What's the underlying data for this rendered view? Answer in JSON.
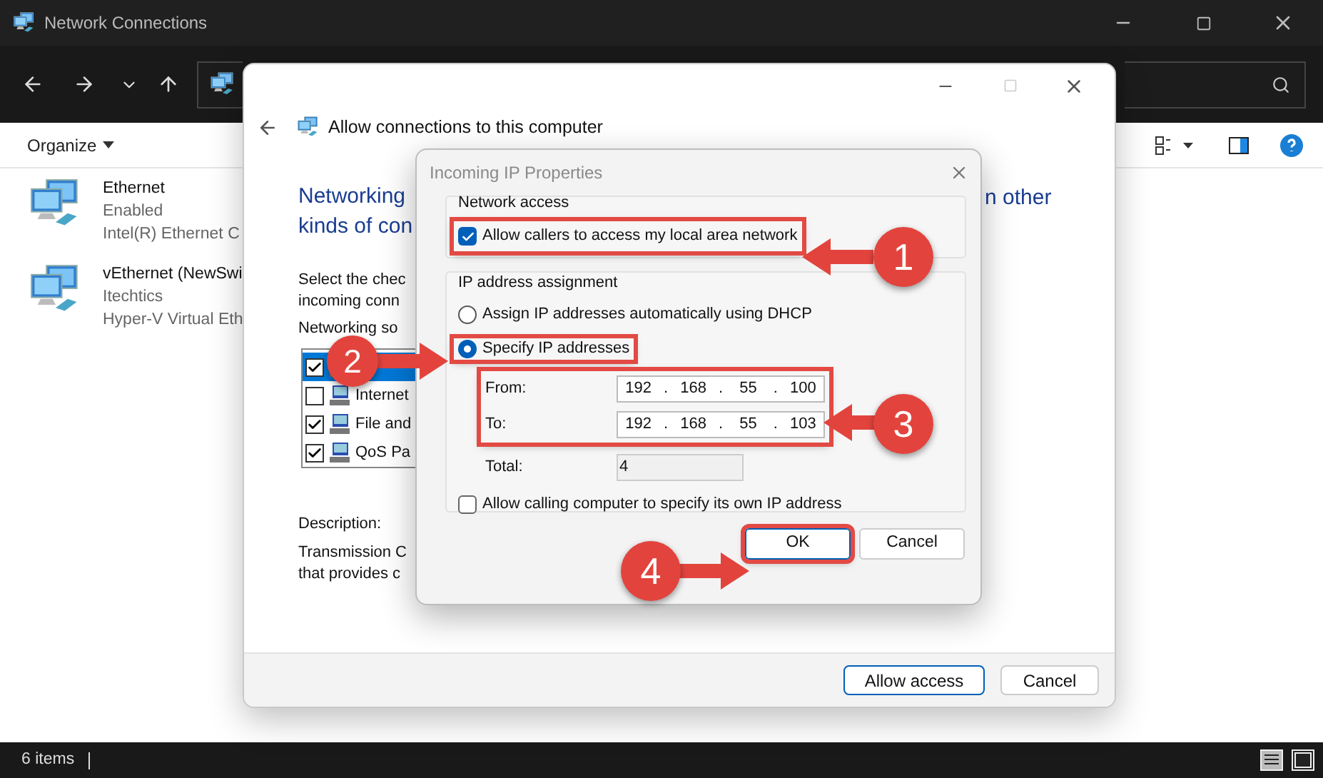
{
  "explorer": {
    "title": "Network Connections",
    "organize": "Organize",
    "connections": [
      {
        "name": "Ethernet",
        "status": "Enabled",
        "device": "Intel(R) Ethernet C"
      },
      {
        "name": "vEthernet (NewSwi",
        "status": "Itechtics",
        "device": "Hyper-V Virtual Eth"
      }
    ],
    "status_bar": "6 items"
  },
  "wizard": {
    "title": "Allow connections to this computer",
    "heading_lines": [
      "Networking",
      "kinds of con"
    ],
    "heading_right": "n other",
    "instructions": [
      "Select the chec",
      "incoming conn"
    ],
    "software_label": "Networking so",
    "software": [
      {
        "checked": true,
        "selected": true
      },
      {
        "label": "Internet",
        "checked": false,
        "selected": false
      },
      {
        "label": "File and",
        "checked": true,
        "selected": false
      },
      {
        "label": "QoS Pa",
        "checked": true,
        "selected": false
      }
    ],
    "description_label": "Description:",
    "description_lines": [
      "Transmission C",
      "that provides c"
    ],
    "buttons": [
      {
        "label": "Allow access",
        "default": true
      },
      {
        "label": "Cancel",
        "default": false
      }
    ]
  },
  "dialog": {
    "title": "Incoming IP Properties",
    "network_access": {
      "legend": "Network access",
      "checkbox": {
        "label": "Allow callers to access my local area network",
        "checked": true,
        "highlighted": true
      }
    },
    "ip_assignment": {
      "legend": "IP address assignment",
      "options": [
        {
          "label": "Assign IP addresses automatically using DHCP",
          "selected": false,
          "highlighted": false
        },
        {
          "label": "Specify IP addresses",
          "selected": true,
          "highlighted": true
        }
      ],
      "range_highlighted": true,
      "separator": ".",
      "range": [
        {
          "label": "From:",
          "octets": [
            "192",
            "168",
            "55",
            "100"
          ]
        },
        {
          "label": "To:",
          "octets": [
            "192",
            "168",
            "55",
            "103"
          ]
        }
      ],
      "total": {
        "label": "Total:",
        "value": "4"
      },
      "own_ip": {
        "label": "Allow calling computer to specify its own IP address",
        "checked": false
      }
    },
    "buttons": [
      {
        "label": "OK",
        "default": true,
        "highlighted": true
      },
      {
        "label": "Cancel",
        "default": false,
        "highlighted": false
      }
    ]
  },
  "annotations": [
    {
      "number": "1"
    },
    {
      "number": "2"
    },
    {
      "number": "3"
    },
    {
      "number": "4"
    }
  ]
}
